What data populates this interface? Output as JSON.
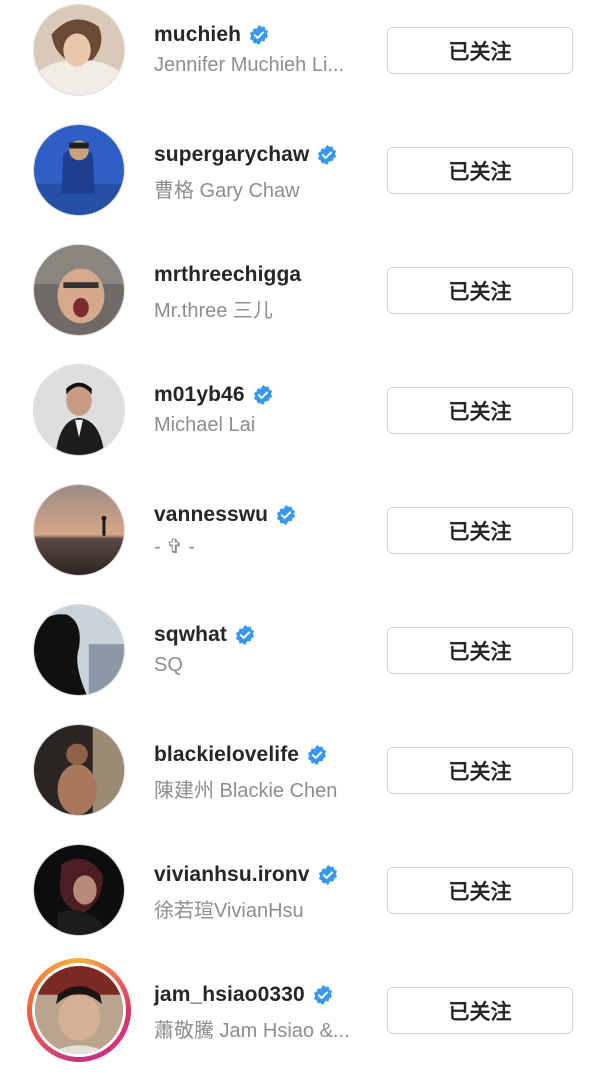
{
  "follow_list": {
    "items": [
      {
        "username": "muchieh",
        "full_name": "Jennifer Muchieh Li...",
        "verified": true,
        "button_label": "已关注",
        "avatar_icon": "profile-photo",
        "story_ring": false
      },
      {
        "username": "supergarychaw",
        "full_name": "曹格 Gary Chaw",
        "verified": true,
        "button_label": "已关注",
        "avatar_icon": "profile-photo",
        "story_ring": false
      },
      {
        "username": "mrthreechigga",
        "full_name": "Mr.three 三儿",
        "verified": false,
        "button_label": "已关注",
        "avatar_icon": "profile-photo",
        "story_ring": false
      },
      {
        "username": "m01yb46",
        "full_name": "Michael Lai",
        "verified": true,
        "button_label": "已关注",
        "avatar_icon": "profile-photo",
        "story_ring": false
      },
      {
        "username": "vannesswu",
        "full_name": "- ✞ -",
        "verified": true,
        "button_label": "已关注",
        "avatar_icon": "profile-photo",
        "story_ring": false
      },
      {
        "username": "sqwhat",
        "full_name": "SQ",
        "verified": true,
        "button_label": "已关注",
        "avatar_icon": "profile-photo",
        "story_ring": false
      },
      {
        "username": "blackielovelife",
        "full_name": "陳建州 Blackie Chen",
        "verified": true,
        "button_label": "已关注",
        "avatar_icon": "profile-photo",
        "story_ring": false
      },
      {
        "username": "vivianhsu.ironv",
        "full_name": "徐若瑄VivianHsu",
        "verified": true,
        "button_label": "已关注",
        "avatar_icon": "profile-photo",
        "story_ring": false
      },
      {
        "username": "jam_hsiao0330",
        "full_name": "蕭敬騰 Jam Hsiao &...",
        "verified": true,
        "button_label": "已关注",
        "avatar_icon": "profile-photo",
        "story_ring": true
      }
    ]
  },
  "colors": {
    "verified_badge": "#3897f0",
    "username_text": "#262626",
    "fullname_text": "#8e8e8e",
    "button_border": "#d4d4d4"
  }
}
